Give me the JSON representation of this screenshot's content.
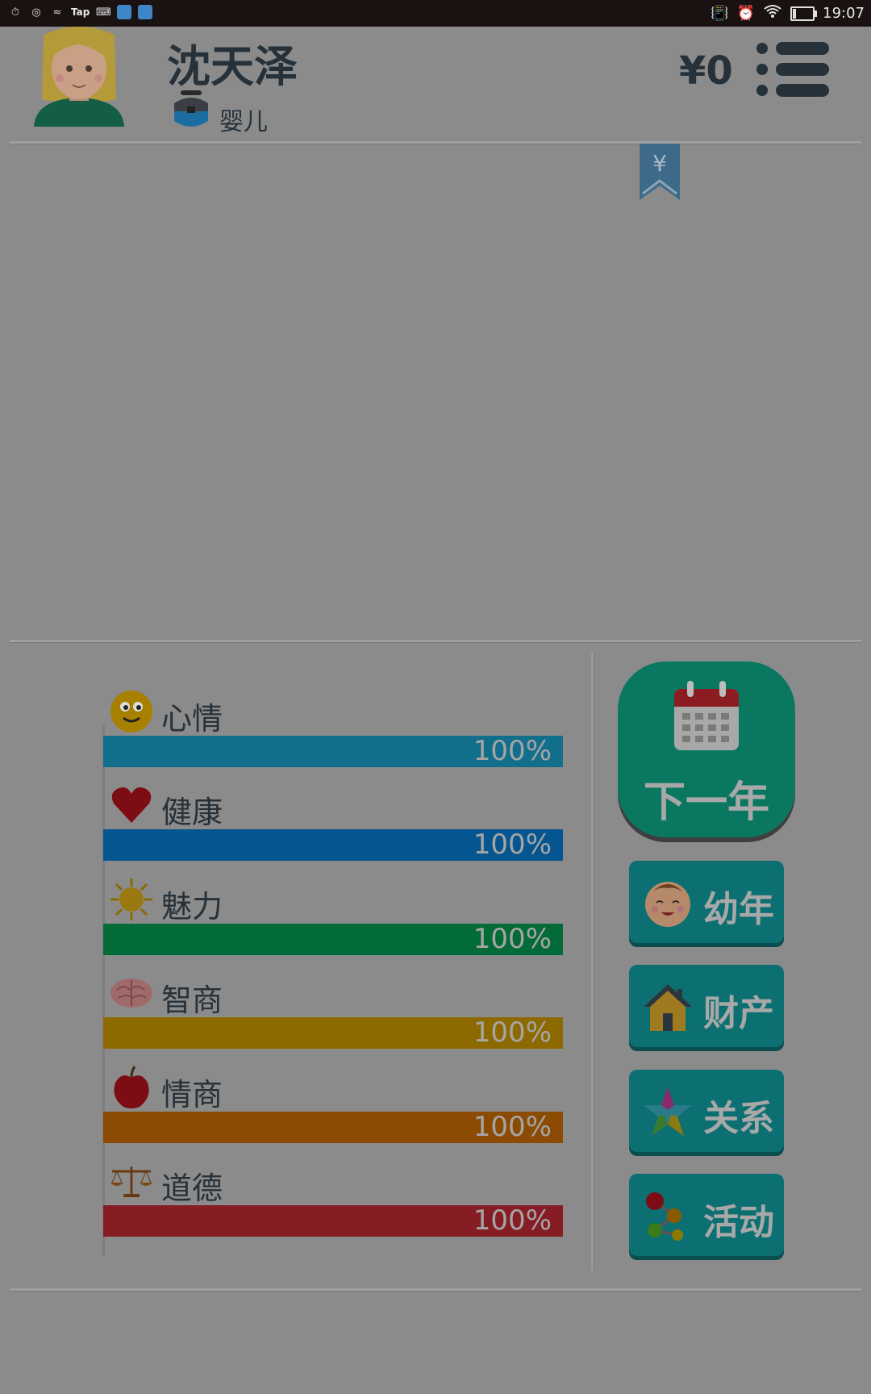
{
  "status_bar": {
    "tap_label": "Tap",
    "time": "19:07"
  },
  "header": {
    "name": "沈天泽",
    "stage": "婴儿",
    "money": "¥0"
  },
  "bookmark_symbol": "¥",
  "stats": [
    {
      "label": "心情",
      "percent": "100%",
      "value": 100,
      "color": "#126f8c",
      "icon": "smiley-icon"
    },
    {
      "label": "健康",
      "percent": "100%",
      "value": 100,
      "color": "#055590",
      "icon": "heart-icon"
    },
    {
      "label": "魅力",
      "percent": "100%",
      "value": 100,
      "color": "#036b37",
      "icon": "sun-icon"
    },
    {
      "label": "智商",
      "percent": "100%",
      "value": 100,
      "color": "#8d6a00",
      "icon": "brain-icon"
    },
    {
      "label": "情商",
      "percent": "100%",
      "value": 100,
      "color": "#8b4b03",
      "icon": "apple-icon"
    },
    {
      "label": "道德",
      "percent": "100%",
      "value": 100,
      "color": "#861d25",
      "icon": "scales-icon"
    }
  ],
  "actions": {
    "next_year": "下一年",
    "buttons": [
      {
        "label": "幼年",
        "icon": "baby-face-icon"
      },
      {
        "label": "财产",
        "icon": "house-icon"
      },
      {
        "label": "关系",
        "icon": "star-icon"
      },
      {
        "label": "活动",
        "icon": "molecule-icon"
      }
    ]
  }
}
